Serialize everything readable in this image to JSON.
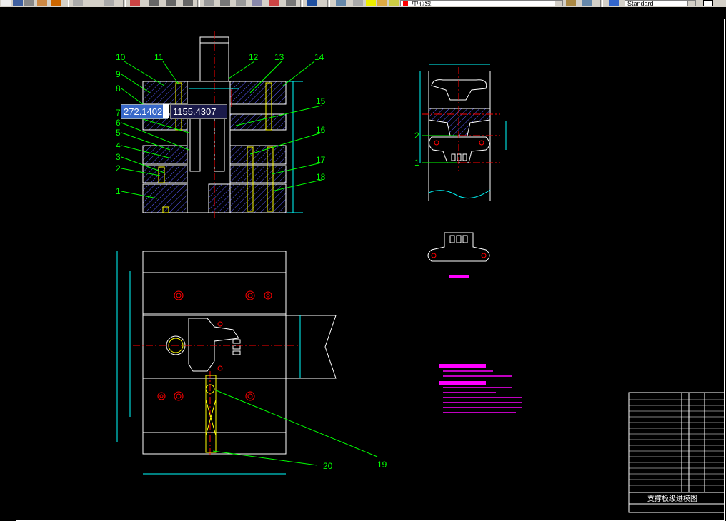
{
  "toolbar": {
    "layer_name": "中心线",
    "text_style": "Standard"
  },
  "drawing": {
    "coordinate_x": "272.1402",
    "coordinate_y": "1155.4307",
    "front_view_callouts_left": [
      "10",
      "9",
      "8",
      "7",
      "6",
      "5",
      "4",
      "3",
      "2",
      "1"
    ],
    "front_view_callouts_top": [
      "11",
      "12",
      "13",
      "14"
    ],
    "front_view_callouts_right": [
      "15",
      "16",
      "17",
      "18"
    ],
    "plan_callouts": [
      "20",
      "19"
    ],
    "strip_callouts": [
      "2",
      "1"
    ],
    "title_block_title": "支撑板级进模图"
  },
  "colors": {
    "background": "#000000",
    "outline": "#ffffff",
    "leader": "#00ff00",
    "centerline": "#ff0000",
    "hatch": "#5a5aff",
    "dimension": "#00ffff",
    "bolt": "#ffff00",
    "note": "#ff00ff"
  }
}
